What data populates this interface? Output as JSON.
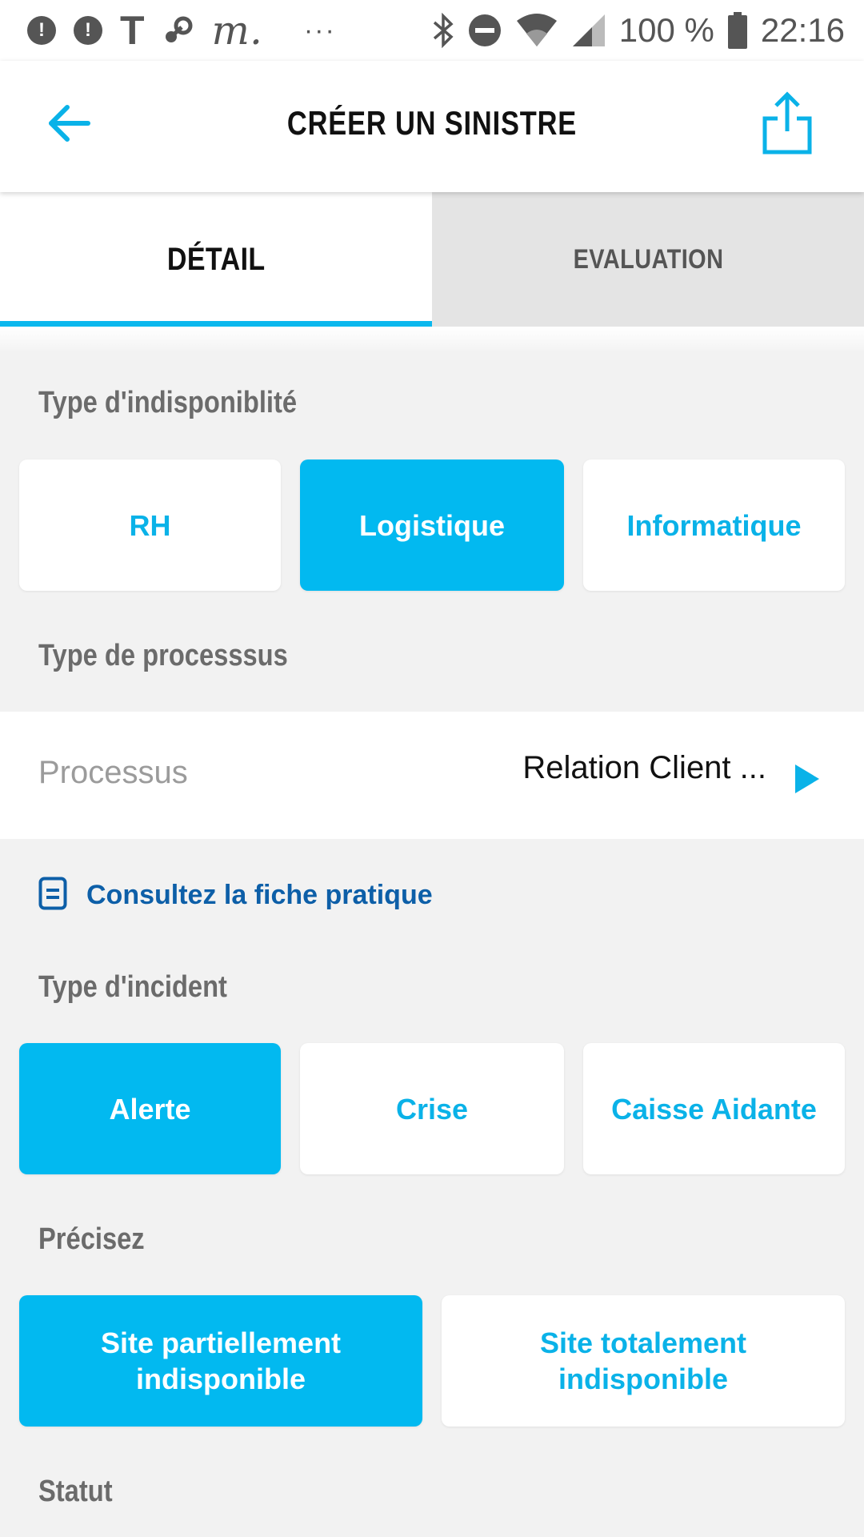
{
  "status_bar": {
    "notif_1": "!",
    "notif_2": "!",
    "notif_t": "T",
    "notif_m": "m.",
    "more": "···",
    "battery_percent": "100 %",
    "time": "22:16",
    "icons": [
      "bluetooth-icon",
      "do-not-disturb-icon",
      "wifi-icon",
      "signal-icon",
      "battery-icon"
    ]
  },
  "app_bar": {
    "title": "CRÉER UN SINISTRE",
    "back_icon": "arrow-left-icon",
    "share_icon": "share-icon"
  },
  "tabs": [
    {
      "label": "DÉTAIL",
      "active": true
    },
    {
      "label": "EVALUATION",
      "active": false
    }
  ],
  "indisponibilite": {
    "label": "Type d'indisponiblité",
    "options": [
      {
        "label": "RH",
        "selected": false
      },
      {
        "label": "Logistique",
        "selected": true
      },
      {
        "label": "Informatique",
        "selected": false
      }
    ]
  },
  "processus": {
    "section_label": "Type de processsus",
    "field_label": "Processus",
    "value": "Relation Client ..."
  },
  "fiche": {
    "label": "Consultez la fiche pratique",
    "icon": "document-icon"
  },
  "incident": {
    "label": "Type d'incident",
    "options": [
      {
        "label": "Alerte",
        "selected": true
      },
      {
        "label": "Crise",
        "selected": false
      },
      {
        "label": "Caisse Aidante",
        "selected": false
      }
    ]
  },
  "precisez": {
    "label": "Précisez",
    "options": [
      {
        "line1": "Site partiellement",
        "line2": "indisponible",
        "selected": true
      },
      {
        "line1": "Site totalement",
        "line2": "indisponible",
        "selected": false
      }
    ]
  },
  "statut": {
    "label": "Statut"
  },
  "colors": {
    "accent": "#02b9f0",
    "link": "#0d5fa8",
    "background": "#f2f2f2"
  }
}
